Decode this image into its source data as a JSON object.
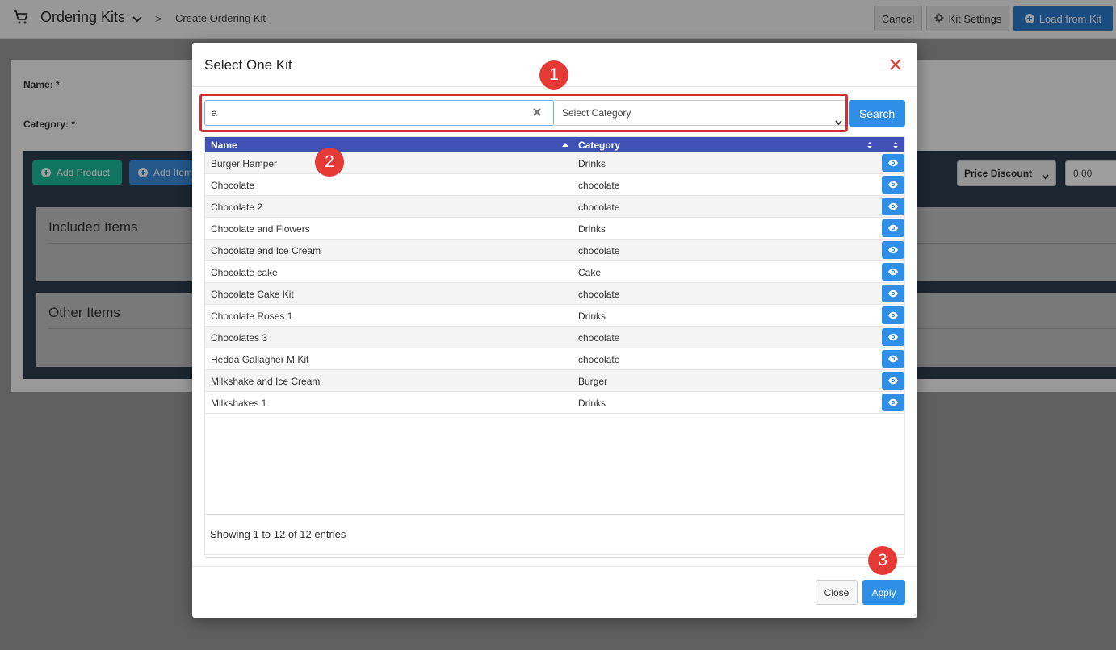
{
  "header": {
    "app_title": "Ordering Kits",
    "breadcrumb_sep": ">",
    "breadcrumb": "Create Ordering Kit",
    "cancel_label": "Cancel",
    "kit_settings_label": "Kit Settings",
    "load_from_kit_label": "Load from Kit"
  },
  "form": {
    "name_label": "Name: *",
    "category_label": "Category: *"
  },
  "toolbar": {
    "add_product_label": "Add Product",
    "add_item_label": "Add Item",
    "price_discount_label": "Price Discount",
    "discount_value": "0.00"
  },
  "sections": {
    "included_title": "Included Items",
    "other_title": "Other Items"
  },
  "modal": {
    "title": "Select One Kit",
    "search_value": "a",
    "category_placeholder": "Select Category",
    "search_label": "Search",
    "columns": {
      "name": "Name",
      "category": "Category"
    },
    "rows": [
      {
        "name": "Burger Hamper",
        "category": "Drinks"
      },
      {
        "name": "Chocolate",
        "category": "chocolate"
      },
      {
        "name": "Chocolate 2",
        "category": "chocolate"
      },
      {
        "name": "Chocolate and Flowers",
        "category": "Drinks"
      },
      {
        "name": "Chocolate and Ice Cream",
        "category": "chocolate"
      },
      {
        "name": "Chocolate cake",
        "category": "Cake"
      },
      {
        "name": "Chocolate Cake Kit",
        "category": "chocolate"
      },
      {
        "name": "Chocolate Roses 1",
        "category": "Drinks"
      },
      {
        "name": "Chocolates 3",
        "category": "chocolate"
      },
      {
        "name": "Hedda Gallagher M Kit",
        "category": "chocolate"
      },
      {
        "name": "Milkshake and Ice Cream",
        "category": "Burger"
      },
      {
        "name": "Milkshakes 1",
        "category": "Drinks"
      }
    ],
    "entries_info": "Showing 1 to 12 of 12 entries",
    "close_label": "Close",
    "apply_label": "Apply"
  },
  "annotations": {
    "badge_1": "1",
    "badge_2": "2",
    "badge_3": "3"
  },
  "colors": {
    "primary": "#2f8ee6",
    "table_header": "#3f51b5",
    "add_product": "#1abc9c",
    "highlight": "#d32f2f",
    "badge": "#e53935",
    "items_frame": "#2c3e50"
  },
  "icons": [
    "cart-icon",
    "chevron-down-icon",
    "gear-icon",
    "plus-circle-icon",
    "close-icon",
    "clear-icon",
    "sort-icon",
    "eye-icon"
  ]
}
